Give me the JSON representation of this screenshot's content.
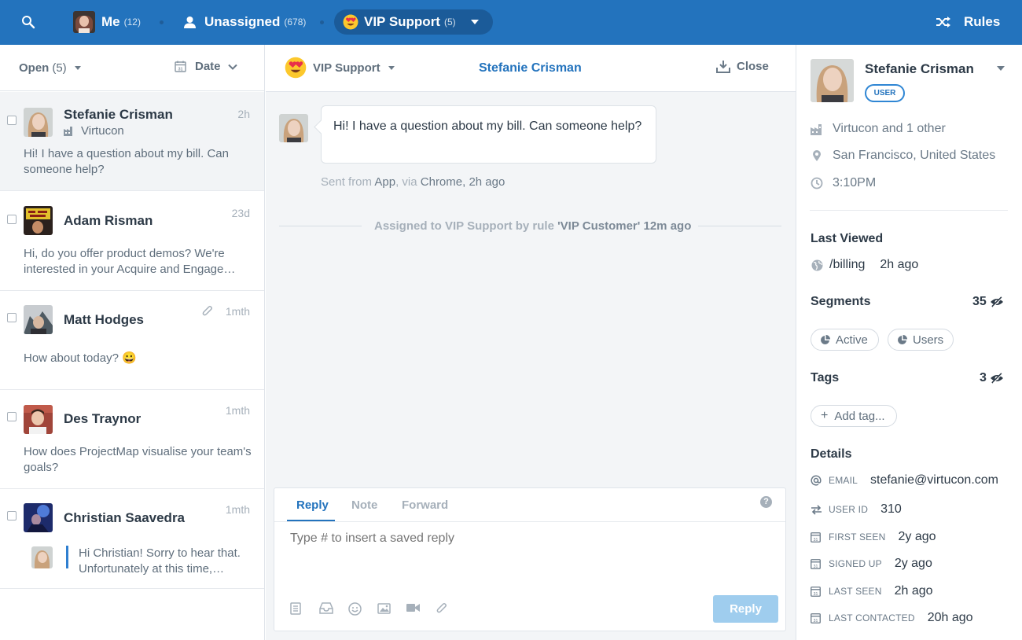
{
  "topbar": {
    "me_label": "Me",
    "me_count": "(12)",
    "unassigned_label": "Unassigned",
    "unassigned_count": "(678)",
    "vip_label": "VIP Support",
    "vip_count": "(5)",
    "rules_label": "Rules",
    "icons": [
      "search-icon",
      "user-icon",
      "heart-eyes-emoji-icon",
      "caret-down-icon",
      "shuffle-icon"
    ]
  },
  "inbox": {
    "filter_label": "Open",
    "filter_count": "(5)",
    "sort_label": "Date",
    "conversations": [
      {
        "name": "Stefanie Crisman",
        "time": "2h",
        "company": "Virtucon",
        "preview": "Hi! I have a question about my bill. Can someone help?"
      },
      {
        "name": "Adam Risman",
        "time": "23d",
        "preview": "Hi, do you offer product demos? We're interested in your Acquire and Engage…"
      },
      {
        "name": "Matt Hodges",
        "time": "1mth",
        "preview": "How about today? 😀"
      },
      {
        "name": "Des Traynor",
        "time": "1mth",
        "preview": "How does ProjectMap visualise your team's goals?"
      },
      {
        "name": "Christian Saavedra",
        "time": "1mth",
        "preview": "Hi Christian! Sorry to hear that. Unfortunately at this time,…"
      }
    ]
  },
  "conversation": {
    "team_label": "VIP Support",
    "title": "Stefanie Crisman",
    "close_label": "Close",
    "message": "Hi! I have a question about my bill. Can someone help?",
    "meta": {
      "sent_from": "Sent from",
      "app": "App",
      "via": ", via",
      "browser": "Chrome",
      "ago": ", 2h ago"
    },
    "system": {
      "prefix": "Assigned to VIP Support by rule",
      "rule": "'VIP Customer'",
      "ago": "12m ago"
    },
    "composer": {
      "tabs": [
        "Reply",
        "Note",
        "Forward"
      ],
      "placeholder": "Type # to insert a saved reply",
      "send_label": "Reply",
      "help": "?"
    }
  },
  "profile": {
    "name": "Stefanie Crisman",
    "badge": "USER",
    "company": "Virtucon and 1 other",
    "location": "San Francisco, United States",
    "local_time": "3:10PM",
    "last_viewed_title": "Last Viewed",
    "last_viewed_page": "/billing",
    "last_viewed_ago": "2h ago",
    "segments_title": "Segments",
    "segments_count": "35",
    "segments": [
      "Active",
      "Users"
    ],
    "tags_title": "Tags",
    "tags_count": "3",
    "add_tag": "Add tag...",
    "details_title": "Details",
    "details": [
      {
        "label": "EMAIL",
        "value": "stefanie@virtucon.com"
      },
      {
        "label": "USER ID",
        "value": "310"
      },
      {
        "label": "FIRST SEEN",
        "value": "2y ago"
      },
      {
        "label": "SIGNED UP",
        "value": "2y ago"
      },
      {
        "label": "LAST SEEN",
        "value": "2h ago"
      },
      {
        "label": "LAST CONTACTED",
        "value": "20h ago"
      }
    ]
  },
  "colors": {
    "brand": "#2373bd",
    "send_button": "#9fcdee",
    "accent_bar": "#2f7fd0"
  }
}
